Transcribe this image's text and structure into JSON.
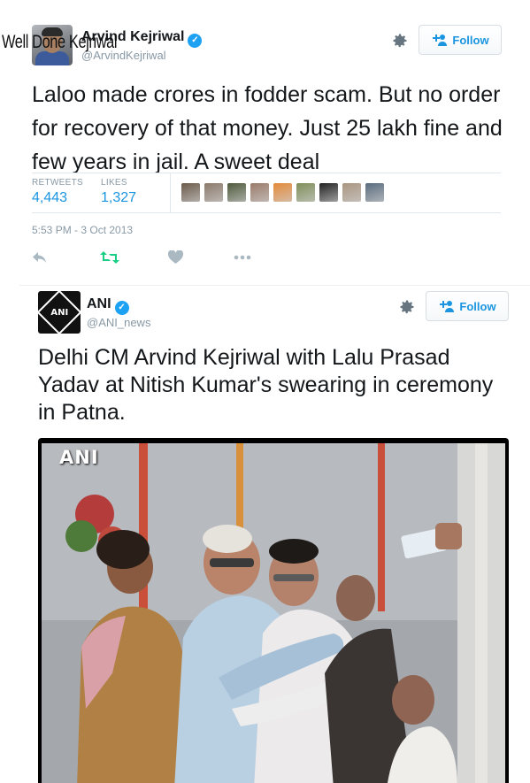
{
  "overlay_caption": "Well Done Kejriwal",
  "tweet1": {
    "display_name": "Arvind Kejriwal",
    "handle": "@ArvindKejriwal",
    "follow_label": "Follow",
    "text": "Laloo made crores in fodder scam. But no order for recovery of that money. Just 25 lakh fine and few years in jail. A sweet deal",
    "retweets_label": "RETWEETS",
    "retweets_value": "4,443",
    "likes_label": "LIKES",
    "likes_value": "1,327",
    "timestamp": "5:53 PM - 3 Oct 2013",
    "liker_avatar_colors": [
      "#6b5a4a",
      "#8c7a6c",
      "#4f5a3c",
      "#9a7b6a",
      "#e58a3a",
      "#7f8f5a",
      "#222222",
      "#a99580",
      "#5a6c7e"
    ]
  },
  "tweet2": {
    "display_name": "ANI",
    "handle": "@ANI_news",
    "follow_label": "Follow",
    "avatar_text": "ANI",
    "text": "Delhi CM Arvind Kejriwal with Lalu Prasad Yadav at Nitish Kumar's swearing in ceremony in Patna.",
    "photo_watermark": "ANI"
  },
  "colors": {
    "link_blue": "#1b95e0",
    "verified_blue": "#1da1f2",
    "muted_gray": "#8899a6",
    "retweet_green": "#19cf86"
  },
  "icons": [
    "gear-icon",
    "follow-person-icon",
    "verified-icon",
    "reply-icon",
    "retweet-icon",
    "like-icon",
    "more-icon"
  ]
}
